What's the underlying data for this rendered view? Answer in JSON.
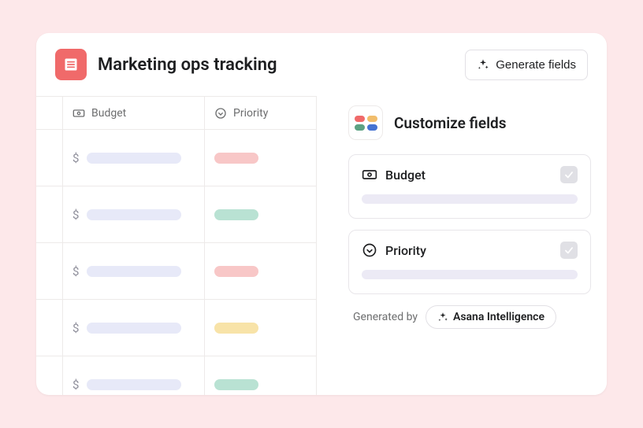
{
  "header": {
    "title": "Marketing ops tracking",
    "generate_button": "Generate fields"
  },
  "table": {
    "columns": {
      "budget": "Budget",
      "priority": "Priority"
    },
    "currency_symbol": "$",
    "rows": [
      {
        "priority_color": "red"
      },
      {
        "priority_color": "green"
      },
      {
        "priority_color": "red"
      },
      {
        "priority_color": "yellow"
      },
      {
        "priority_color": "green"
      }
    ]
  },
  "panel": {
    "title": "Customize fields",
    "fields": [
      {
        "icon": "cash-icon",
        "label": "Budget",
        "checked": true
      },
      {
        "icon": "chevron-down-circle-icon",
        "label": "Priority",
        "checked": true
      }
    ],
    "generated_by_label": "Generated by",
    "generated_by_value": "Asana Intelligence"
  }
}
